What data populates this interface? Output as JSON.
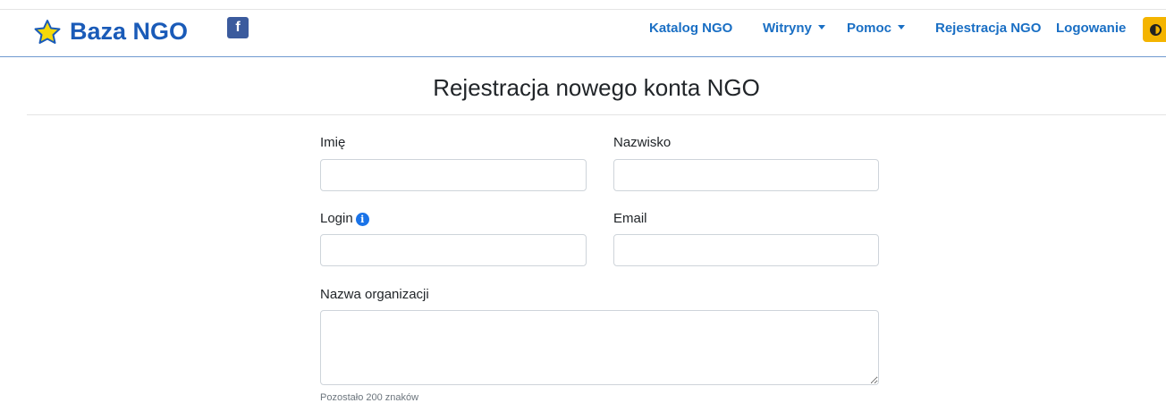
{
  "navbar": {
    "brand": "Baza NGO",
    "facebook_glyph": "f",
    "items": [
      {
        "label": "Katalog NGO"
      },
      {
        "label": "Witryny",
        "dropdown": true
      },
      {
        "label": "Pomoc",
        "dropdown": true
      },
      {
        "label": "Rejestracja NGO"
      },
      {
        "label": "Logowanie"
      }
    ],
    "contrast_icon": "contrast-icon",
    "colors": {
      "brand": "#1a5bb8",
      "link": "#1a6fc4",
      "accent": "#f4b400",
      "facebook": "#3b5b9d"
    }
  },
  "page": {
    "title": "Rejestracja nowego konta NGO"
  },
  "form": {
    "first_name": {
      "label": "Imię",
      "value": "",
      "placeholder": ""
    },
    "last_name": {
      "label": "Nazwisko",
      "value": "",
      "placeholder": ""
    },
    "login": {
      "label": "Login",
      "value": "",
      "placeholder": "",
      "info_glyph": "i"
    },
    "email": {
      "label": "Email",
      "value": "",
      "placeholder": ""
    },
    "organization": {
      "label": "Nazwa organizacji",
      "value": "",
      "placeholder": "",
      "remaining": "Pozostało 200 znaków"
    }
  }
}
